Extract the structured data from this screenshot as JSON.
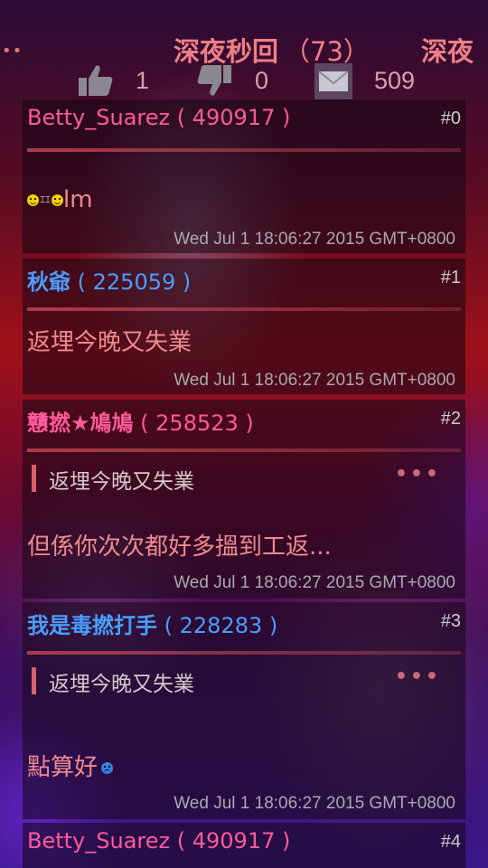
{
  "header": {
    "title": "深夜秒回",
    "title_count": "（73）",
    "next_title": "深夜",
    "likes": "1",
    "dislikes": "0",
    "messages": "509"
  },
  "posts": [
    {
      "username": "Betty_Suarez",
      "uid": "( 490917 )",
      "floor": "#0",
      "content": "lm",
      "timestamp": "Wed Jul 1 18:06:27 2015 GMT+0800"
    },
    {
      "username": "秋爺",
      "uid": "( 225059 )",
      "floor": "#1",
      "content": "返埋今晚又失業",
      "timestamp": "Wed Jul 1 18:06:27 2015 GMT+0800"
    },
    {
      "username": "戇撚★鳩鳩",
      "uid": "( 258523 )",
      "floor": "#2",
      "quote": "返埋今晚又失業",
      "more": "•••",
      "content": "但係你次次都好多搵到工返...",
      "timestamp": "Wed Jul 1 18:06:27 2015 GMT+0800"
    },
    {
      "username": "我是毒撚打手",
      "uid": "( 228283 )",
      "floor": "#3",
      "quote": "返埋今晚又失業",
      "more": "•••",
      "content": "點算好",
      "timestamp": "Wed Jul 1 18:06:27 2015 GMT+0800"
    },
    {
      "username": "Betty_Suarez",
      "uid": "( 490917 )",
      "floor": "#4"
    }
  ],
  "icons": {
    "menu": "dots-icon",
    "like": "thumbs-up-icon",
    "dislike": "thumbs-down-icon",
    "message": "mail-icon"
  },
  "colors": {
    "title": "#ef7f86",
    "username_pink": "#ff5a9a",
    "username_blue": "#4a9dff",
    "content": "#f08a90",
    "timestamp": "#aaa9b0"
  }
}
